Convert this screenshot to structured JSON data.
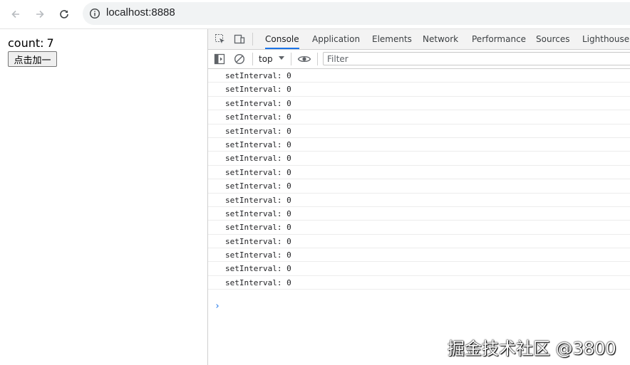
{
  "browser": {
    "url": "localhost:8888",
    "icons": {
      "back": "arrow-left-icon",
      "forward": "arrow-right-icon",
      "reload": "reload-icon",
      "site_info": "info-circle-icon"
    }
  },
  "page": {
    "count_label": "count:",
    "count_value": "7",
    "button_label": "点击加一"
  },
  "devtools": {
    "tabs": [
      {
        "label": "Console",
        "active": true
      },
      {
        "label": "Application",
        "active": false
      },
      {
        "label": "Elements",
        "active": false
      },
      {
        "label": "Network",
        "active": false
      },
      {
        "label": "Performance",
        "active": false
      },
      {
        "label": "Sources",
        "active": false
      },
      {
        "label": "Lighthouse",
        "active": false
      }
    ],
    "console": {
      "context": "top",
      "filter_placeholder": "Filter",
      "logs": [
        "setInterval: 0",
        "setInterval: 0",
        "setInterval: 0",
        "setInterval: 0",
        "setInterval: 0",
        "setInterval: 0",
        "setInterval: 0",
        "setInterval: 0",
        "setInterval: 0",
        "setInterval: 0",
        "setInterval: 0",
        "setInterval: 0",
        "setInterval: 0",
        "setInterval: 0",
        "setInterval: 0",
        "setInterval: 0"
      ],
      "prompt": "›"
    },
    "accent_color": "#1a73e8"
  },
  "watermark": "掘金技术社区 @3800"
}
